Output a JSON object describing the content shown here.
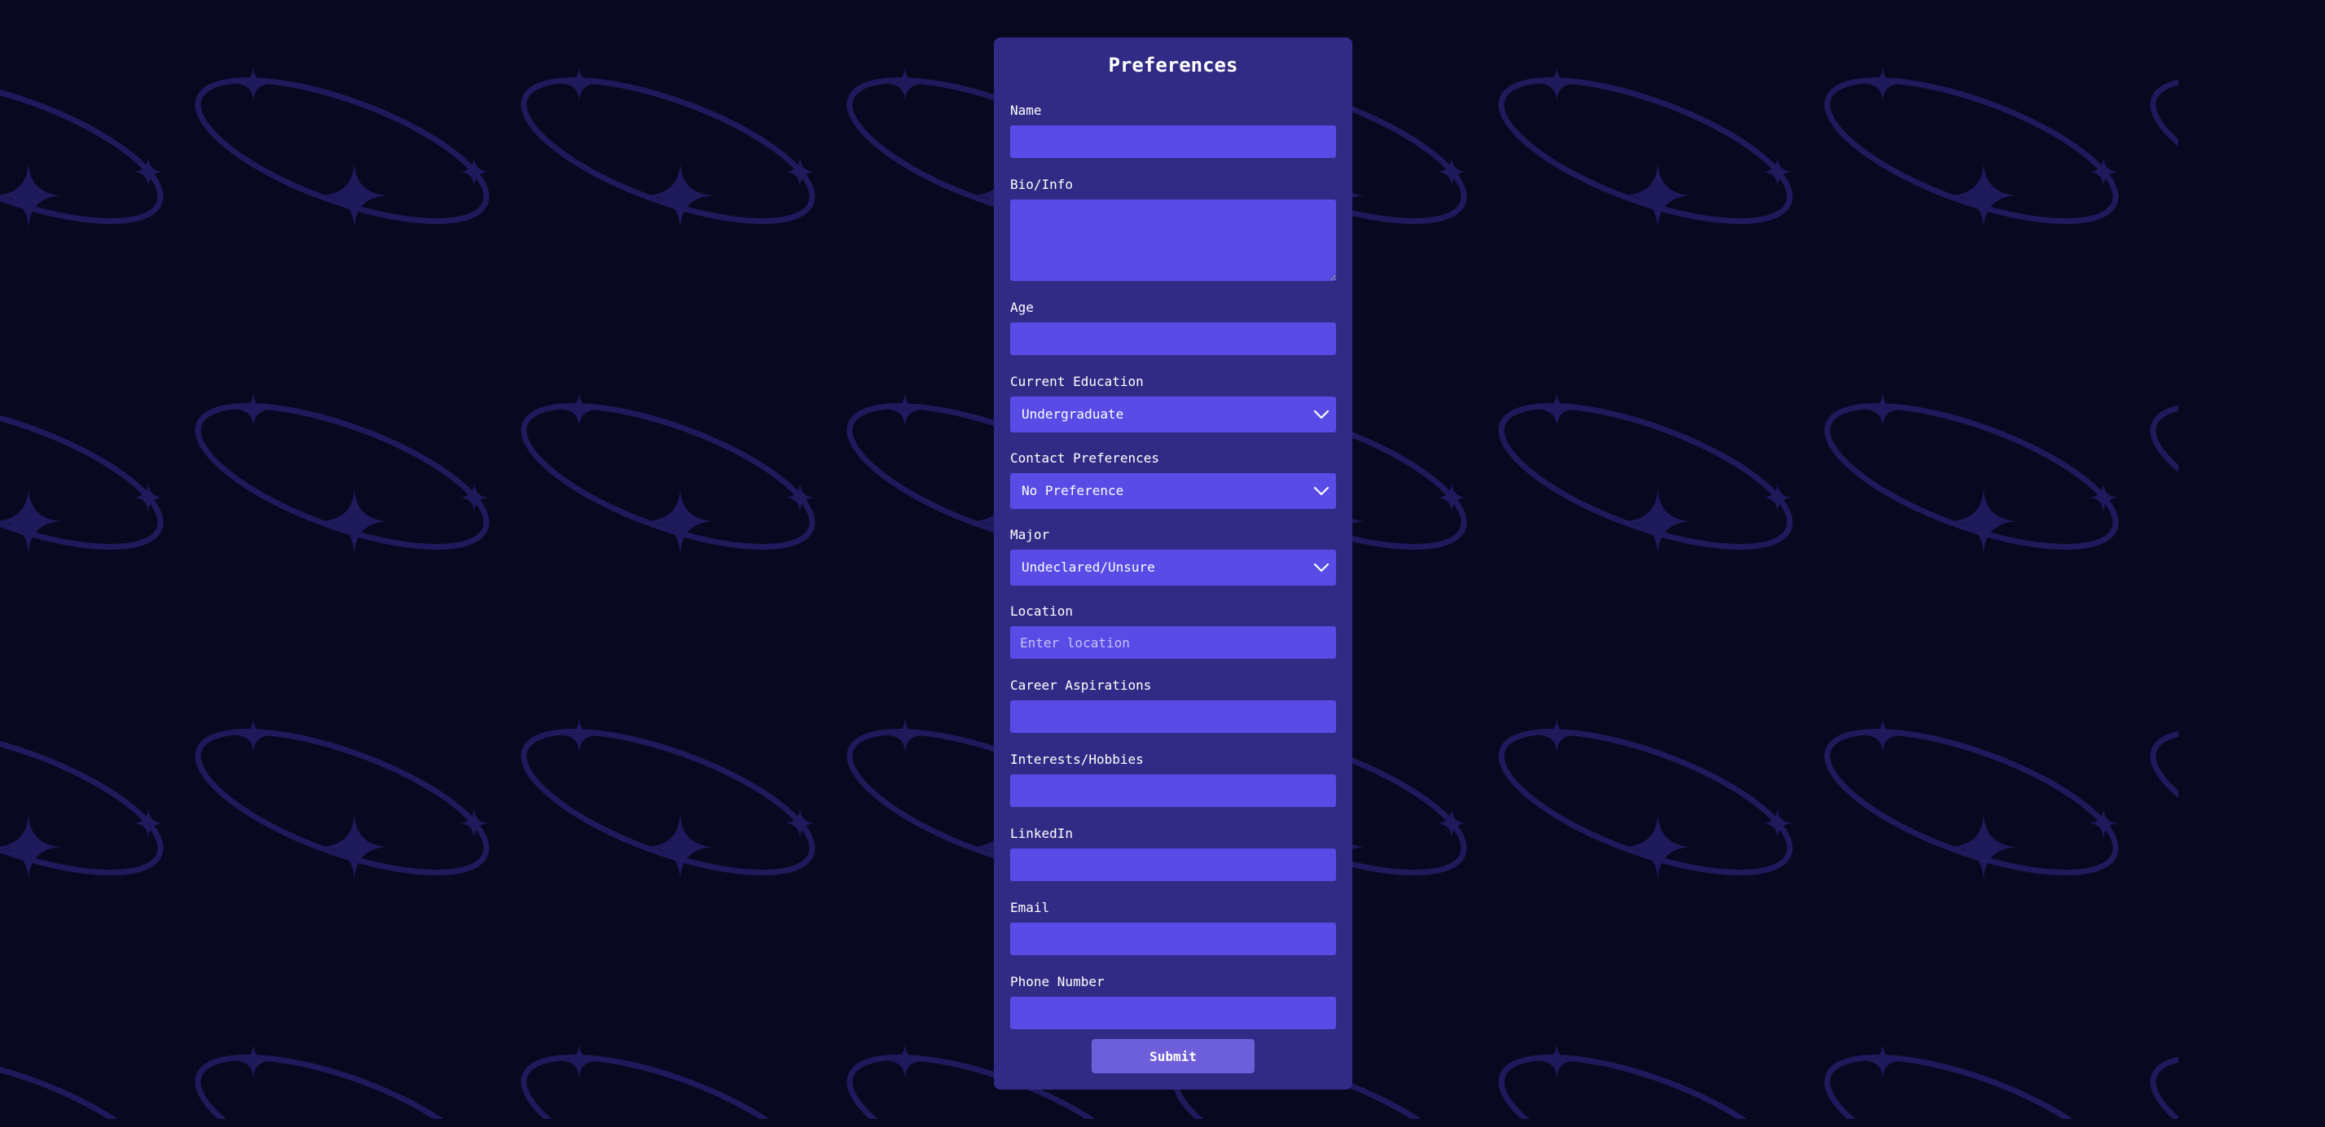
{
  "form": {
    "title": "Preferences",
    "fields": {
      "name": {
        "label": "Name",
        "value": ""
      },
      "bio": {
        "label": "Bio/Info",
        "value": ""
      },
      "age": {
        "label": "Age",
        "value": ""
      },
      "education": {
        "label": "Current Education",
        "selected": "Undergraduate"
      },
      "contact": {
        "label": "Contact Preferences",
        "selected": "No Preference"
      },
      "major": {
        "label": "Major",
        "selected": "Undeclared/Unsure"
      },
      "location": {
        "label": "Location",
        "value": "",
        "placeholder": "Enter location"
      },
      "career": {
        "label": "Career Aspirations",
        "value": ""
      },
      "interests": {
        "label": "Interests/Hobbies",
        "value": ""
      },
      "linkedin": {
        "label": "LinkedIn",
        "value": ""
      },
      "email": {
        "label": "Email",
        "value": ""
      },
      "phone": {
        "label": "Phone Number",
        "value": ""
      }
    },
    "submit_label": "Submit"
  },
  "icons": {
    "dropdown": "chevron-down-icon",
    "background": "saturn-sparkle-icon"
  },
  "colors": {
    "page_background": "#080820",
    "pattern": "#1e1a5c",
    "card_background": "#322b85",
    "input_background": "#584be6",
    "button_background": "#6c5fd9",
    "text": "#ffffff"
  }
}
